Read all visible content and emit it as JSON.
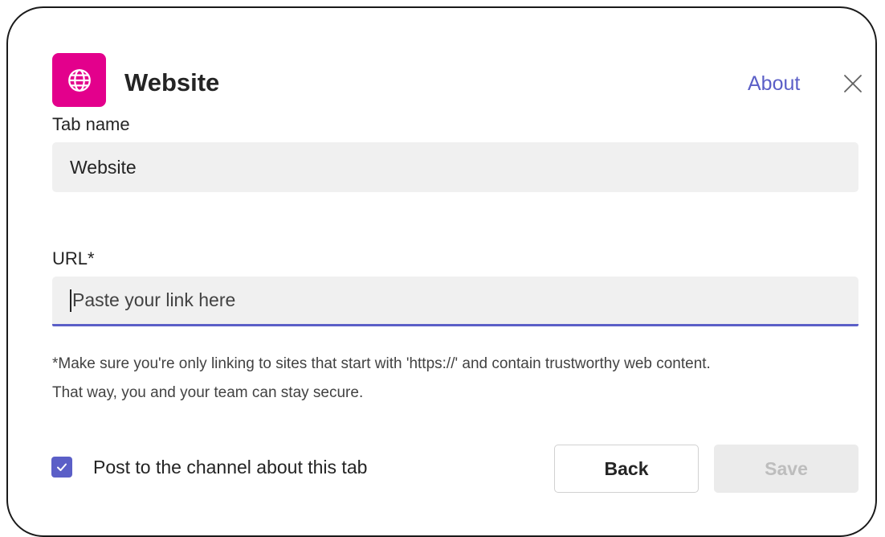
{
  "header": {
    "app_icon": "globe-icon",
    "title": "Website",
    "about_label": "About",
    "close_icon": "close-icon"
  },
  "form": {
    "tab_name": {
      "label": "Tab name",
      "value": "Website"
    },
    "url": {
      "label": "URL*",
      "value": "",
      "placeholder": "Paste your link here"
    },
    "note_line1": "*Make sure you're only linking to sites that start with 'https://' and contain trustworthy web content.",
    "note_line2": "That way, you and your team can stay secure."
  },
  "footer": {
    "post_checkbox_checked": true,
    "post_checkbox_label": "Post to the channel about this tab",
    "back_label": "Back",
    "save_label": "Save",
    "save_enabled": false
  },
  "colors": {
    "app_icon_bg": "#e3008c",
    "accent": "#5b5fc7",
    "input_bg": "#f0f0f0"
  }
}
